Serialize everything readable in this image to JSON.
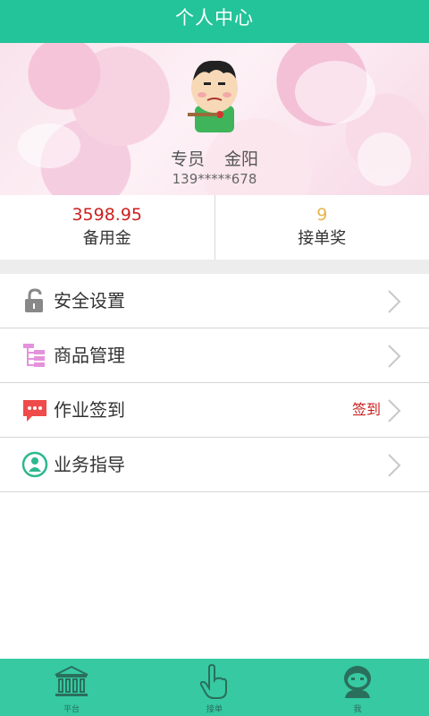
{
  "header": {
    "title": "个人中心"
  },
  "profile": {
    "role": "专员",
    "name": "金阳",
    "phone": "139*****678"
  },
  "stats": [
    {
      "value": "3598.95",
      "label": "备用金",
      "color": "#cc1f1f"
    },
    {
      "value": "9",
      "label": "接单奖",
      "color": "#e8b44a"
    }
  ],
  "menu": [
    {
      "label": "安全设置",
      "icon": "lock-icon",
      "extra": ""
    },
    {
      "label": "商品管理",
      "icon": "product-tree-icon",
      "extra": ""
    },
    {
      "label": "作业签到",
      "icon": "message-icon",
      "extra": "签到"
    },
    {
      "label": "业务指导",
      "icon": "guide-person-icon",
      "extra": ""
    }
  ],
  "tabbar": [
    {
      "label": "平台",
      "icon": "bank-icon"
    },
    {
      "label": "接单",
      "icon": "hand-pointer-icon"
    },
    {
      "label": "我",
      "icon": "user-icon"
    }
  ],
  "colors": {
    "brand": "#23c49a",
    "tabbar": "#36c9a2",
    "alert": "#cc1f1f",
    "gold": "#e8b44a"
  }
}
